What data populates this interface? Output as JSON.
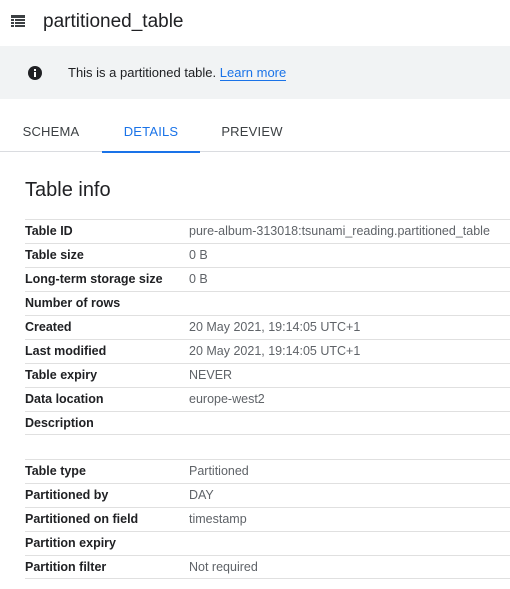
{
  "header": {
    "icon": "table-icon",
    "title": "partitioned_table"
  },
  "banner": {
    "icon": "info-icon",
    "text": "This is a partitioned table.",
    "link_label": "Learn more"
  },
  "tabs": [
    {
      "label": "SCHEMA",
      "active": false
    },
    {
      "label": "DETAILS",
      "active": true
    },
    {
      "label": "PREVIEW",
      "active": false
    }
  ],
  "accent_color": "#1a73e8",
  "table_info": {
    "title": "Table info",
    "rows": [
      {
        "label": "Table ID",
        "value": "pure-album-313018:tsunami_reading.partitioned_table"
      },
      {
        "label": "Table size",
        "value": "0 B"
      },
      {
        "label": "Long-term storage size",
        "value": "0 B"
      },
      {
        "label": "Number of rows",
        "value": ""
      },
      {
        "label": "Created",
        "value": "20 May 2021, 19:14:05 UTC+1"
      },
      {
        "label": "Last modified",
        "value": "20 May 2021, 19:14:05 UTC+1"
      },
      {
        "label": "Table expiry",
        "value": "NEVER"
      },
      {
        "label": "Data location",
        "value": "europe-west2"
      },
      {
        "label": "Description",
        "value": ""
      }
    ]
  },
  "partition_info": {
    "rows": [
      {
        "label": "Table type",
        "value": "Partitioned"
      },
      {
        "label": "Partitioned by",
        "value": "DAY"
      },
      {
        "label": "Partitioned on field",
        "value": "timestamp"
      },
      {
        "label": "Partition expiry",
        "value": ""
      },
      {
        "label": "Partition filter",
        "value": "Not required"
      }
    ]
  }
}
